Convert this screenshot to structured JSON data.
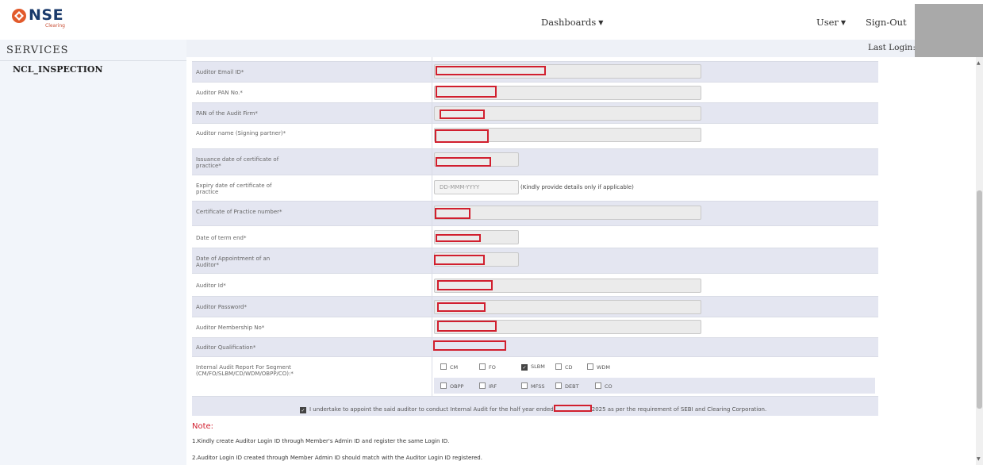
{
  "header": {
    "logo_text": "NSE",
    "logo_sub": "Clearing",
    "nav_dashboards": "Dashboards",
    "nav_user": "User",
    "nav_signout": "Sign-Out",
    "last_login": "Last Login:"
  },
  "sidebar": {
    "title": "SERVICES",
    "items": [
      {
        "label": "NCL_INSPECTION"
      }
    ]
  },
  "form": {
    "rows": [
      {
        "label": "Auditor Email ID*"
      },
      {
        "label": "Auditor PAN No.*"
      },
      {
        "label": "PAN of the Audit Firm*"
      },
      {
        "label": "Auditor name (Signing partner)*"
      },
      {
        "label": "Issuance date of certificate of practice*"
      },
      {
        "label": "Expiry date of certificate of practice",
        "placeholder": "DD-MMM-YYYY",
        "hint": "(Kindly provide details only if applicable)"
      },
      {
        "label": "Certificate of Practice number*"
      },
      {
        "label": "Date of term end*"
      },
      {
        "label": "Date of Appointment of an Auditor*"
      },
      {
        "label": "Auditor Id*"
      },
      {
        "label": "Auditor Password*"
      },
      {
        "label": "Auditor Membership No*"
      },
      {
        "label": "Auditor Qualification*"
      },
      {
        "label": "Internal Audit Report For Segment (CM/FO/SLBM/CD/WDM/OBPP/CO):*"
      }
    ],
    "segments_row1": [
      {
        "label": "CM",
        "checked": false
      },
      {
        "label": "FO",
        "checked": false
      },
      {
        "label": "SLBM",
        "checked": true
      },
      {
        "label": "CD",
        "checked": false
      },
      {
        "label": "WDM",
        "checked": false
      }
    ],
    "segments_row2": [
      {
        "label": "OBPP",
        "checked": false
      },
      {
        "label": "IRF",
        "checked": false
      },
      {
        "label": "MFSS",
        "checked": false
      },
      {
        "label": "DEBT",
        "checked": false
      },
      {
        "label": "CO",
        "checked": false
      }
    ],
    "undertake_before": "I undertake to appoint the said auditor to conduct Internal Audit for the half year ended",
    "undertake_after": "2025 as per the requirement of SEBI and Clearing Corporation."
  },
  "note": {
    "title": "Note:",
    "lines": [
      "1.Kindly create Auditor Login ID through Member's Admin ID and register the same Login ID.",
      "2.Auditor Login ID created through Member Admin ID should match with the Auditor Login ID registered."
    ]
  },
  "colors": {
    "redaction": "#d11f2e",
    "row_shade": "#e4e6f1",
    "sidebar_bg": "#f2f5fa"
  }
}
